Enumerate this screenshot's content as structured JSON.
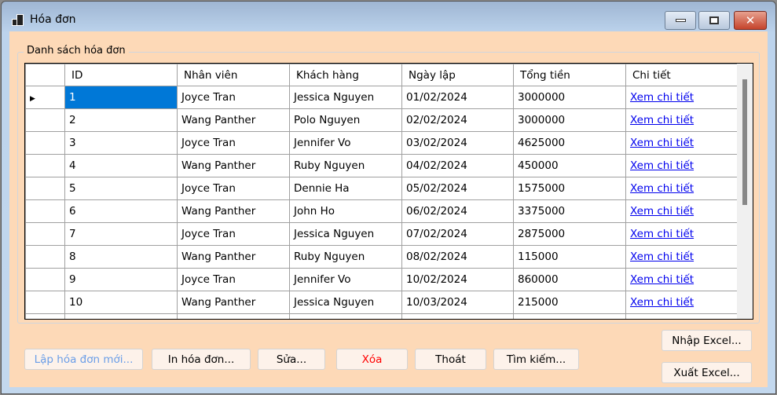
{
  "window": {
    "title": "Hóa đơn"
  },
  "group_label": "Danh sách hóa đơn",
  "columns": [
    "ID",
    "Nhân viên",
    "Khách hàng",
    "Ngày lập",
    "Tổng tiền",
    "Chi tiết"
  ],
  "rows": [
    [
      "1",
      "Joyce Tran",
      "Jessica Nguyen",
      "01/02/2024",
      "3000000",
      "Xem chi tiết"
    ],
    [
      "2",
      "Wang Panther",
      "Polo Nguyen",
      "02/02/2024",
      "3000000",
      "Xem chi tiết"
    ],
    [
      "3",
      "Joyce Tran",
      "Jennifer Vo",
      "03/02/2024",
      "4625000",
      "Xem chi tiết"
    ],
    [
      "4",
      "Wang Panther",
      "Ruby Nguyen",
      "04/02/2024",
      "450000",
      "Xem chi tiết"
    ],
    [
      "5",
      "Joyce Tran",
      "Dennie Ha",
      "05/02/2024",
      "1575000",
      "Xem chi tiết"
    ],
    [
      "6",
      "Wang Panther",
      "John Ho",
      "06/02/2024",
      "3375000",
      "Xem chi tiết"
    ],
    [
      "7",
      "Joyce Tran",
      "Jessica Nguyen",
      "07/02/2024",
      "2875000",
      "Xem chi tiết"
    ],
    [
      "8",
      "Wang Panther",
      "Ruby Nguyen",
      "08/02/2024",
      "115000",
      "Xem chi tiết"
    ],
    [
      "9",
      "Joyce Tran",
      "Jennifer Vo",
      "10/02/2024",
      "860000",
      "Xem chi tiết"
    ],
    [
      "10",
      "Wang Panther",
      "Jessica Nguyen",
      "10/03/2024",
      "215000",
      "Xem chi tiết"
    ]
  ],
  "buttons": {
    "new": "Lập hóa đơn mới...",
    "print": "In hóa đơn...",
    "edit": "Sửa...",
    "delete": "Xóa",
    "exit": "Thoát",
    "search": "Tìm kiếm...",
    "import": "Nhập Excel...",
    "export": "Xuất Excel..."
  }
}
